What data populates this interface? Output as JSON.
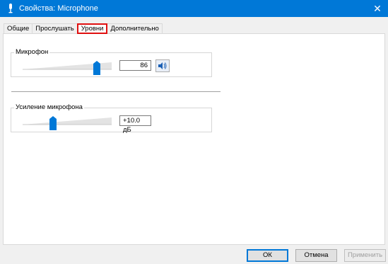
{
  "window": {
    "title": "Свойства: Microphone",
    "icon": "microphone-icon",
    "close_glyph": "✕",
    "accent": "#0078d7"
  },
  "tabs": [
    {
      "label": "Общие"
    },
    {
      "label": "Прослушать"
    },
    {
      "label": "Уровни",
      "selected": true
    },
    {
      "label": "Дополнительно"
    }
  ],
  "levels": {
    "microphone": {
      "label": "Микрофон",
      "value_text": "86",
      "level": 86,
      "mute_icon": "speaker-icon"
    },
    "boost": {
      "label": "Усиление микрофона",
      "value_text": "+10.0 дБ",
      "level_fraction": 0.33
    }
  },
  "buttons": {
    "ok": "ОК",
    "cancel": "Отмена",
    "apply": "Применить"
  }
}
